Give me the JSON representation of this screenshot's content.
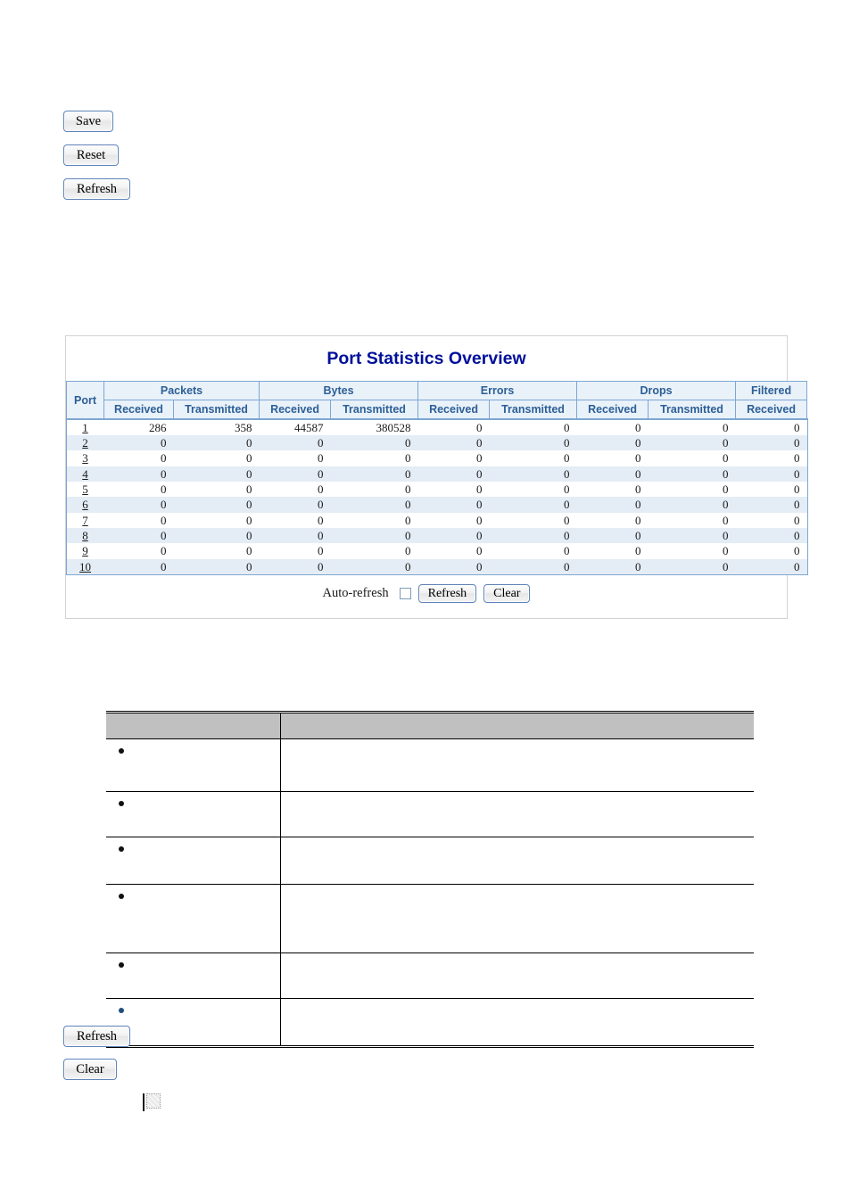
{
  "top_buttons": [
    {
      "label": "Save",
      "name": "save-button"
    },
    {
      "label": "Reset",
      "name": "reset-button"
    },
    {
      "label": "Refresh",
      "name": "refresh-button-top"
    }
  ],
  "bottom_buttons": [
    {
      "label": "Refresh",
      "name": "refresh-button-bottom"
    },
    {
      "label": "Clear",
      "name": "clear-button-bottom"
    }
  ],
  "stats_panel": {
    "title": "Port Statistics Overview",
    "group_headers": [
      {
        "label": "Port",
        "rowspan": 2,
        "colspan": 1
      },
      {
        "label": "Packets",
        "rowspan": 1,
        "colspan": 2
      },
      {
        "label": "Bytes",
        "rowspan": 1,
        "colspan": 2
      },
      {
        "label": "Errors",
        "rowspan": 1,
        "colspan": 2
      },
      {
        "label": "Drops",
        "rowspan": 1,
        "colspan": 2
      },
      {
        "label": "Filtered",
        "rowspan": 1,
        "colspan": 1
      }
    ],
    "sub_headers": [
      "Received",
      "Transmitted",
      "Received",
      "Transmitted",
      "Received",
      "Transmitted",
      "Received",
      "Transmitted",
      "Received"
    ],
    "rows": [
      {
        "port": "1",
        "values": [
          "286",
          "358",
          "44587",
          "380528",
          "0",
          "0",
          "0",
          "0",
          "0"
        ]
      },
      {
        "port": "2",
        "values": [
          "0",
          "0",
          "0",
          "0",
          "0",
          "0",
          "0",
          "0",
          "0"
        ]
      },
      {
        "port": "3",
        "values": [
          "0",
          "0",
          "0",
          "0",
          "0",
          "0",
          "0",
          "0",
          "0"
        ]
      },
      {
        "port": "4",
        "values": [
          "0",
          "0",
          "0",
          "0",
          "0",
          "0",
          "0",
          "0",
          "0"
        ]
      },
      {
        "port": "5",
        "values": [
          "0",
          "0",
          "0",
          "0",
          "0",
          "0",
          "0",
          "0",
          "0"
        ]
      },
      {
        "port": "6",
        "values": [
          "0",
          "0",
          "0",
          "0",
          "0",
          "0",
          "0",
          "0",
          "0"
        ]
      },
      {
        "port": "7",
        "values": [
          "0",
          "0",
          "0",
          "0",
          "0",
          "0",
          "0",
          "0",
          "0"
        ]
      },
      {
        "port": "8",
        "values": [
          "0",
          "0",
          "0",
          "0",
          "0",
          "0",
          "0",
          "0",
          "0"
        ]
      },
      {
        "port": "9",
        "values": [
          "0",
          "0",
          "0",
          "0",
          "0",
          "0",
          "0",
          "0",
          "0"
        ]
      },
      {
        "port": "10",
        "values": [
          "0",
          "0",
          "0",
          "0",
          "0",
          "0",
          "0",
          "0",
          "0"
        ]
      }
    ],
    "controls": {
      "auto_refresh_label": "Auto-refresh",
      "auto_refresh_checked": false,
      "refresh_label": "Refresh",
      "clear_label": "Clear"
    },
    "colors": {
      "title": "#00109A",
      "header_bg": "#E9F1F9",
      "header_text": "#2C5F96",
      "grid_border": "#7DA7D2",
      "alt_row_bg": "#E4ECF5",
      "panel_border": "#D2D2D2"
    }
  },
  "description_table": {
    "header": {
      "col1": "",
      "col2": ""
    },
    "rows": [
      {
        "col1": "",
        "col2": ""
      },
      {
        "col1": "",
        "col2": ""
      },
      {
        "col1": "",
        "col2": ""
      },
      {
        "col1": "",
        "col2": ""
      },
      {
        "col1": "",
        "col2": ""
      },
      {
        "col1": "",
        "col2": ""
      }
    ],
    "header_bg": "#C0C0C0"
  }
}
